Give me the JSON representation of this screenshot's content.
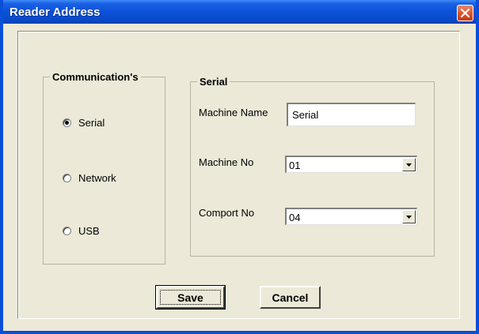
{
  "window": {
    "title": "Reader Address",
    "close_icon": "close-icon",
    "accent": "#0a4fd8",
    "close_color": "#d6502b"
  },
  "communications": {
    "legend": "Communication's",
    "options": [
      {
        "label": "Serial",
        "checked": true
      },
      {
        "label": "Network",
        "checked": false
      },
      {
        "label": "USB",
        "checked": false
      }
    ]
  },
  "serial": {
    "legend": "Serial",
    "machine_name_label": "Machine Name",
    "machine_name_value": "Serial",
    "machine_no_label": "Machine No",
    "machine_no_value": "01",
    "comport_no_label": "Comport No",
    "comport_no_value": "04"
  },
  "buttons": {
    "save": "Save",
    "cancel": "Cancel"
  }
}
